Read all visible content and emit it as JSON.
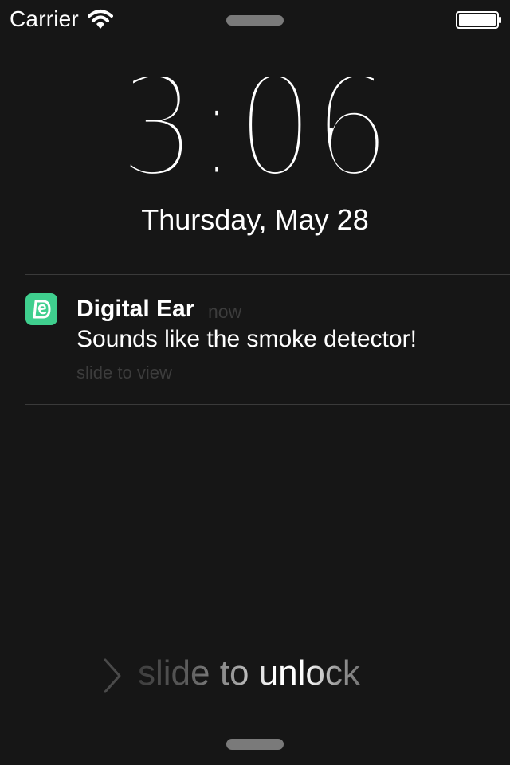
{
  "status_bar": {
    "carrier": "Carrier",
    "wifi_icon": "wifi-icon",
    "battery_icon": "battery-full-icon"
  },
  "lock_screen": {
    "time": "3:06",
    "date": "Thursday, May 28"
  },
  "notification": {
    "app_name": "Digital Ear",
    "time": "now",
    "message": "Sounds like the smoke detector!",
    "action": "slide to view",
    "icon": "digital-ear-app-icon",
    "icon_color": "#3fcf8e"
  },
  "unlock": {
    "label": "slide to unlock",
    "chevron_icon": "chevron-right-icon"
  },
  "colors": {
    "background": "#161616",
    "text": "#ffffff",
    "dim_text": "#3c3c3c",
    "grabber": "#7a7a7a"
  }
}
